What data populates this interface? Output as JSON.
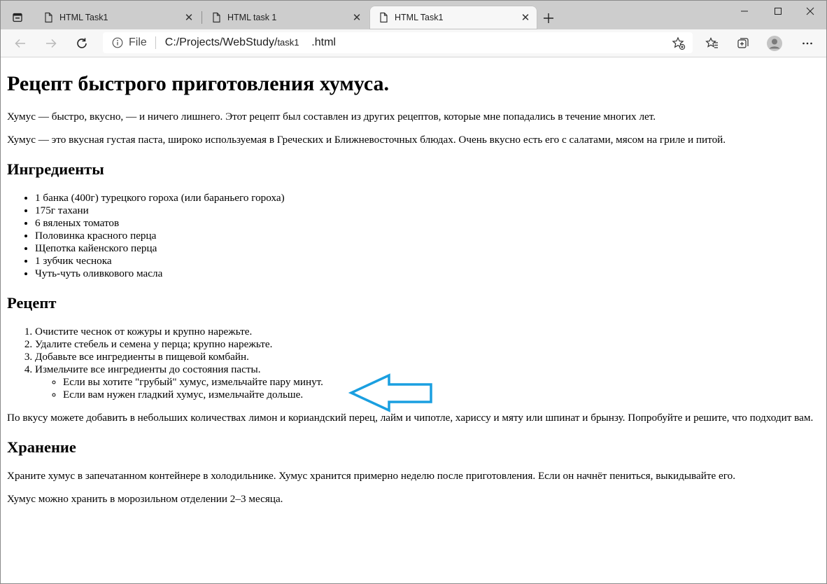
{
  "browser": {
    "tabs": [
      {
        "title": "HTML Task1",
        "active": false
      },
      {
        "title": "HTML task 1",
        "active": false
      },
      {
        "title": "HTML Task1",
        "active": true
      }
    ],
    "address": {
      "scheme": "File",
      "url_prefix": "C:/Projects/WebStudy/",
      "url_middle": "task1",
      "url_suffix": "    .html"
    }
  },
  "page": {
    "title": "Рецепт быстрого приготовления хумуса.",
    "intro": [
      "Хумус — быстро, вкусно, — и ничего лишнего. Этот рецепт был составлен из других рецептов, которые мне попадались в течение многих лет.",
      "Хумус — это вкусная густая паста, широко используемая в Греческих и Ближневосточных блюдах. Очень вкусно есть его с салатами, мясом на гриле и питой."
    ],
    "ingredients_heading": "Ингредиенты",
    "ingredients": [
      "1 банка (400г) турецкого гороха (или бараньего гороха)",
      "175г тахани",
      "6 вяленых томатов",
      "Половинка красного перца",
      "Щепотка кайенского перца",
      "1 зубчик чеснока",
      "Чуть-чуть оливкового масла"
    ],
    "recipe_heading": "Рецепт",
    "steps": [
      "Очистите чеснок от кожуры и крупно нарежьте.",
      "Удалите стебель и семена у перца; крупно нарежьте.",
      "Добавьте все ингредиенты в пищевой комбайн.",
      "Измельчите все ингредиенты до состояния пасты."
    ],
    "substeps": [
      "Если вы хотите \"грубый\" хумус, измельчайте пару минут.",
      "Если вам нужен гладкий хумус, измельчайте дольше."
    ],
    "tip": "По вкусу можете добавить в небольших количествах лимон и кориандский перец, лайм и чипотле, хариссу и мяту или шпинат и брынзу. Попробуйте и решите, что подходит вам.",
    "storage_heading": "Хранение",
    "storage": [
      "Храните хумус в запечатанном контейнере в холодильнике. Хумус хранится примерно неделю после приготовления. Если он начнёт пениться, выкидывайте его.",
      "Хумус можно хранить в морозильном отделении 2–3 месяца."
    ]
  },
  "colors": {
    "arrow": "#1a9fe0",
    "tabstrip": "#cdcdcd",
    "toolbar": "#f7f7f7"
  }
}
